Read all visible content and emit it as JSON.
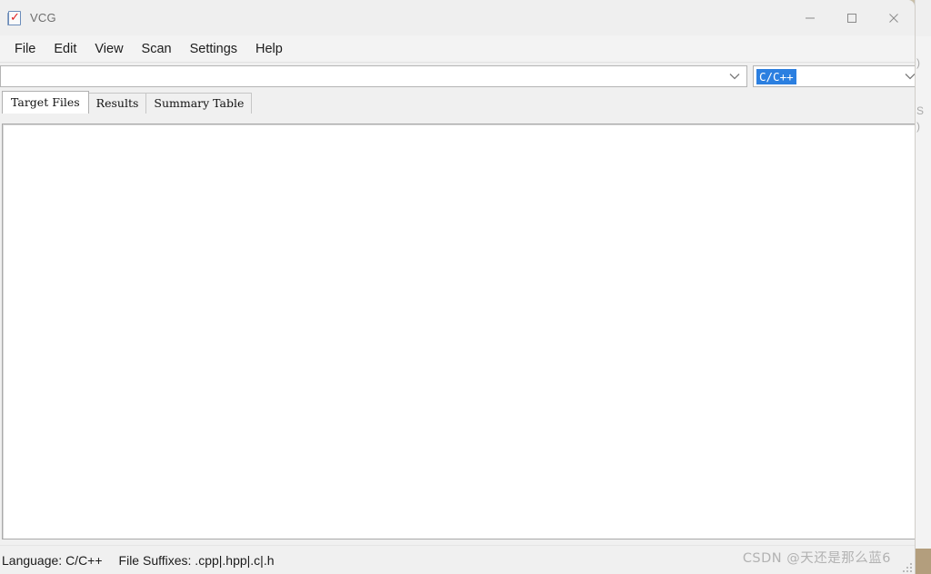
{
  "window": {
    "title": "VCG",
    "icon": "document-check-icon",
    "controls": [
      {
        "name": "minimize",
        "glyph": "minimize-icon"
      },
      {
        "name": "maximize",
        "glyph": "maximize-icon"
      },
      {
        "name": "close",
        "glyph": "close-icon"
      }
    ]
  },
  "menubar": {
    "items": [
      {
        "label": "File"
      },
      {
        "label": "Edit"
      },
      {
        "label": "View"
      },
      {
        "label": "Scan"
      },
      {
        "label": "Settings"
      },
      {
        "label": "Help"
      }
    ]
  },
  "toolbar": {
    "path_combo": {
      "value": "",
      "placeholder": "",
      "icon": "chevron-down-icon"
    },
    "language_combo": {
      "value": "C/C++",
      "selected": true,
      "icon": "chevron-down-icon",
      "highlight_color": "#2b7fe0"
    }
  },
  "tabs": {
    "active_index": 0,
    "items": [
      {
        "label": "Target Files"
      },
      {
        "label": "Results"
      },
      {
        "label": "Summary Table"
      }
    ]
  },
  "content": {
    "empty": true,
    "text": ""
  },
  "statusbar": {
    "language_label": "Language: C/C++",
    "suffixes_label": "File Suffixes: .cpp|.hpp|.c|.h"
  },
  "watermark": {
    "text": "CSDN @天还是那么蓝6"
  },
  "behind_window": {
    "glyph_1": ")",
    "glyph_2": "S",
    "glyph_3": ")"
  },
  "colors": {
    "accent": "#2b7fe0",
    "titlebar": "#efefef",
    "menubar": "#f3f3f3",
    "window_bg": "#f0f0f0",
    "panel_bg": "#ffffff",
    "desktop": "#c9bfa8"
  }
}
